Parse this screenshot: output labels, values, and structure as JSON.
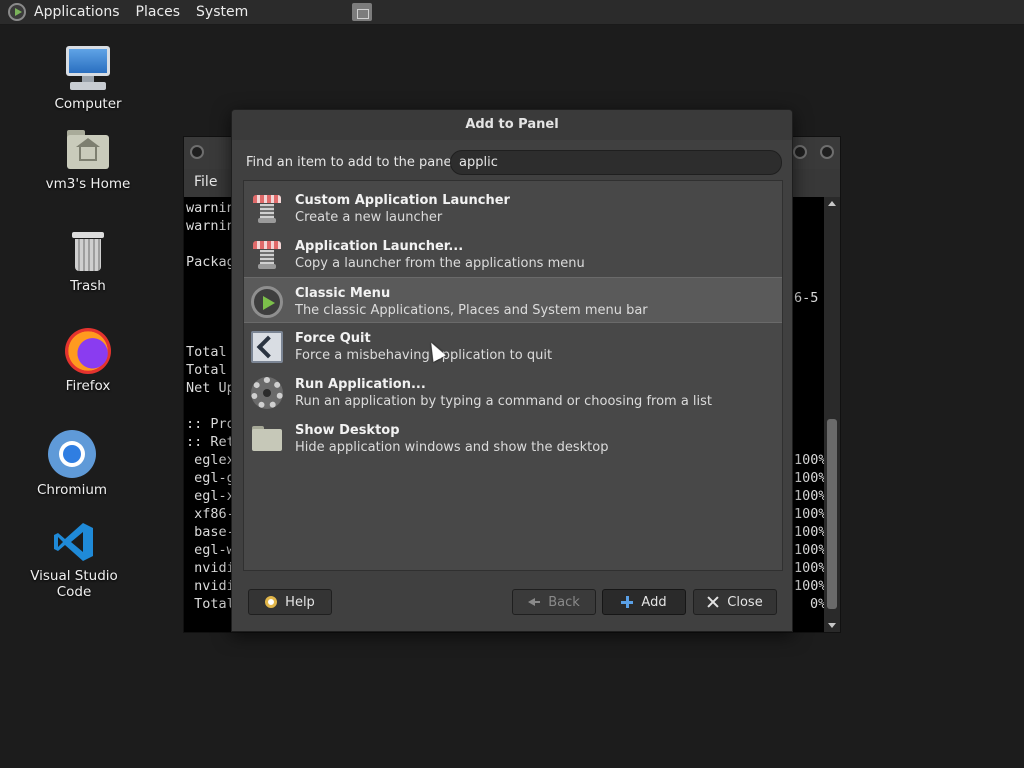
{
  "top_panel": {
    "menus": [
      "Applications",
      "Places",
      "System"
    ]
  },
  "desktop_icons": [
    {
      "label": "Computer"
    },
    {
      "label": "vm3's Home"
    },
    {
      "label": "Trash"
    },
    {
      "label": "Firefox"
    },
    {
      "label": "Chromium"
    },
    {
      "label": "Visual Studio Code"
    }
  ],
  "terminal": {
    "menu_file": "File",
    "left_lines": [
      "warnin",
      "warnin",
      "",
      "Packag",
      "",
      "",
      "",
      "",
      "Total",
      "Total",
      "Net Up",
      "",
      ":: Pro",
      ":: Ret",
      " eglex",
      " egl-g",
      " egl-x",
      " xf86-",
      " base-",
      " egl-w",
      " nvidi",
      " nvidi",
      " Total"
    ],
    "right_lines": {
      "version": "6-5",
      "percents": [
        "100%",
        "100%",
        "100%",
        "100%",
        "100%",
        "100%",
        "100%",
        "100%",
        "0%"
      ]
    }
  },
  "dialog": {
    "title": "Add to Panel",
    "find_label": "Find an item to add to the panel:",
    "search_value": "applic",
    "items": [
      {
        "name": "Custom Application Launcher",
        "desc": "Create a new launcher",
        "icon": "launcher-icon"
      },
      {
        "name": "Application Launcher...",
        "desc": "Copy a launcher from the applications menu",
        "icon": "launcher-icon"
      },
      {
        "name": "Classic Menu",
        "desc": "The classic Applications, Places and System menu bar",
        "icon": "classic-menu-icon"
      },
      {
        "name": "Force Quit",
        "desc": "Force a misbehaving application to quit",
        "icon": "force-quit-icon"
      },
      {
        "name": "Run Application...",
        "desc": "Run an application by typing a command or choosing from a list",
        "icon": "gear-icon"
      },
      {
        "name": "Show Desktop",
        "desc": "Hide application windows and show the desktop",
        "icon": "show-desktop-icon"
      }
    ],
    "selected_index": 2,
    "buttons": {
      "help": "Help",
      "back": "Back",
      "add": "Add",
      "close": "Close"
    }
  }
}
